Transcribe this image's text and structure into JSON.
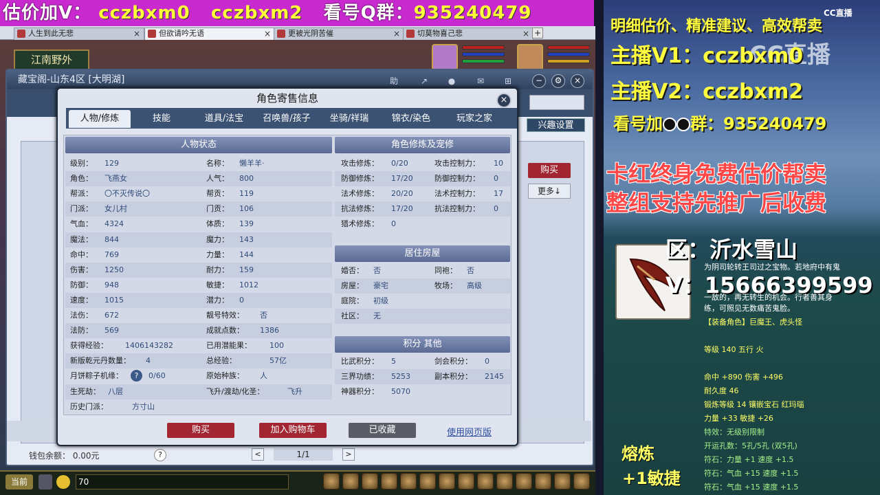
{
  "banner": {
    "prefix": "估价加V：",
    "v1": "cczbxm0",
    "v2": "cczbxm2",
    "qq_label": "看号Q群：",
    "qq": "935240479"
  },
  "browser_tabs": [
    {
      "label": "人生到此无悲"
    },
    {
      "label": "但欲请吟无语"
    },
    {
      "label": "更被光阴苦催"
    },
    {
      "label": "切莫物喜己悲"
    }
  ],
  "game": {
    "location": "江南野外",
    "chat_mode": "当前",
    "chat_input": "70"
  },
  "cbg": {
    "title": "藏宝阁-山东4区 [大明湖]",
    "interest_btn": "兴趣设置",
    "buy_btn": "购买",
    "more_btn": "更多↓",
    "wallet": "钱包余额： 0.00元",
    "help": "?",
    "page": "1/1",
    "prev": "<",
    "next": ">"
  },
  "dialog": {
    "title": "角色寄售信息",
    "close": "×",
    "tabs": [
      "人物/修炼",
      "技能",
      "道具/法宝",
      "召唤兽/孩子",
      "坐骑/祥瑞",
      "锦衣/染色",
      "玩家之家"
    ],
    "active_tab": 0,
    "sections": {
      "status": "人物状态",
      "cultivation": "角色修炼及宠修",
      "house": "居住房屋",
      "points": "积分 其他"
    },
    "left_col": [
      {
        "label": "级别：",
        "value": "129"
      },
      {
        "label": "角色：",
        "value": "飞燕女"
      },
      {
        "label": "帮派：",
        "value": "〇不灭传说〇"
      },
      {
        "label": "门派：",
        "value": "女儿村"
      },
      {
        "label": "气血：",
        "value": "4324"
      },
      {
        "label": "魔法：",
        "value": "844"
      },
      {
        "label": "命中：",
        "value": "769"
      },
      {
        "label": "伤害：",
        "value": "1250"
      },
      {
        "label": "防御：",
        "value": "948"
      },
      {
        "label": "速度：",
        "value": "1015"
      },
      {
        "label": "法伤：",
        "value": "672"
      },
      {
        "label": "法防：",
        "value": "569"
      },
      {
        "label": "获得经验：",
        "value": "1406143282"
      },
      {
        "label": "新版乾元丹数量：",
        "value": "4"
      },
      {
        "label": "月饼粽子机缘：",
        "value": "0/60"
      },
      {
        "label": "生死劫：",
        "value": "八层"
      },
      {
        "label": "历史门派：",
        "value": "方寸山"
      }
    ],
    "mid_col": [
      {
        "label": "名称：",
        "value": "懒羊羊·"
      },
      {
        "label": "人气：",
        "value": "800"
      },
      {
        "label": "帮贡：",
        "value": "119"
      },
      {
        "label": "门贡：",
        "value": "106"
      },
      {
        "label": "体质：",
        "value": "139"
      },
      {
        "label": "魔力：",
        "value": "143"
      },
      {
        "label": "力量：",
        "value": "144"
      },
      {
        "label": "耐力：",
        "value": "159"
      },
      {
        "label": "敏捷：",
        "value": "1012"
      },
      {
        "label": "潜力：",
        "value": "0"
      },
      {
        "label": "靓号特效：",
        "value": "否"
      },
      {
        "label": "成就点数：",
        "value": "1386"
      },
      {
        "label": "已用潜能果：",
        "value": "100"
      },
      {
        "label": "总经验：",
        "value": "57亿"
      },
      {
        "label": "原始种族：",
        "value": "人"
      },
      {
        "label": "飞升/渡劫/化圣：",
        "value": "飞升"
      }
    ],
    "cult_col1": [
      {
        "label": "攻击修炼：",
        "value": "0/20"
      },
      {
        "label": "防御修炼：",
        "value": "17/20"
      },
      {
        "label": "法术修炼：",
        "value": "20/20"
      },
      {
        "label": "抗法修炼：",
        "value": "17/20"
      },
      {
        "label": "猎术修炼：",
        "value": "0"
      }
    ],
    "cult_col2": [
      {
        "label": "攻击控制力：",
        "value": "10"
      },
      {
        "label": "防御控制力：",
        "value": "0"
      },
      {
        "label": "法术控制力：",
        "value": "17"
      },
      {
        "label": "抗法控制力：",
        "value": "0"
      }
    ],
    "house_col1": [
      {
        "label": "婚否：",
        "value": "否"
      },
      {
        "label": "房屋：",
        "value": "豪宅"
      },
      {
        "label": "庭院：",
        "value": "初级"
      },
      {
        "label": "社区：",
        "value": "无"
      }
    ],
    "house_col2": [
      {
        "label": "同袍：",
        "value": "否"
      },
      {
        "label": "牧场：",
        "value": "高级"
      }
    ],
    "points_col1": [
      {
        "label": "比武积分：",
        "value": "5"
      },
      {
        "label": "三界功绩：",
        "value": "5253"
      },
      {
        "label": "神器积分：",
        "value": "5070"
      }
    ],
    "points_col2": [
      {
        "label": "剑会积分：",
        "value": "0"
      },
      {
        "label": "副本积分：",
        "value": "2145"
      }
    ],
    "buttons": {
      "buy": "购买",
      "cart": "加入购物车",
      "fav": "已收藏",
      "web": "使用网页版"
    }
  },
  "stream": {
    "line1": "明细估价、精准建议、高效帮卖",
    "line2": "主播V1：cczbxm0",
    "line3": "主播V2：cczbxm2",
    "line4": "看号加",
    "line4b": "群：935240479",
    "line5": "卡红终身免费估价帮卖",
    "line6": "整组支持先推广后收费",
    "cc_logo": "CC直播",
    "cc_center": "CC直播",
    "zone": "区：沂水雪山",
    "vid": "V：15666399599",
    "item_desc": [
      "为阴司轮转王司过之宝物。若地府中有鬼",
      "一敌的，再无转生的机会。行者善其身",
      "练，可照见无数痛苦鬼脸。"
    ],
    "item_role": "【装备角色】巨魔王、虎头怪",
    "item_level": "等级 140  五行 火",
    "item_stats": [
      "命中 +890 伤害 +496",
      "耐久度 46",
      "锻炼等级 14  镶嵌宝石 红玛瑙",
      "力量 +33 敏捷 +26"
    ],
    "item_special": [
      "特效：无级别限制",
      "开运孔数：5孔/5孔 (双5孔)",
      "符石：力量 +1 速度 +1.5",
      "符石：气血 +15 速度 +1.5",
      "符石：气血 +15 速度 +1.5"
    ],
    "fuse1": "熔炼",
    "fuse2": "+1敏捷"
  }
}
